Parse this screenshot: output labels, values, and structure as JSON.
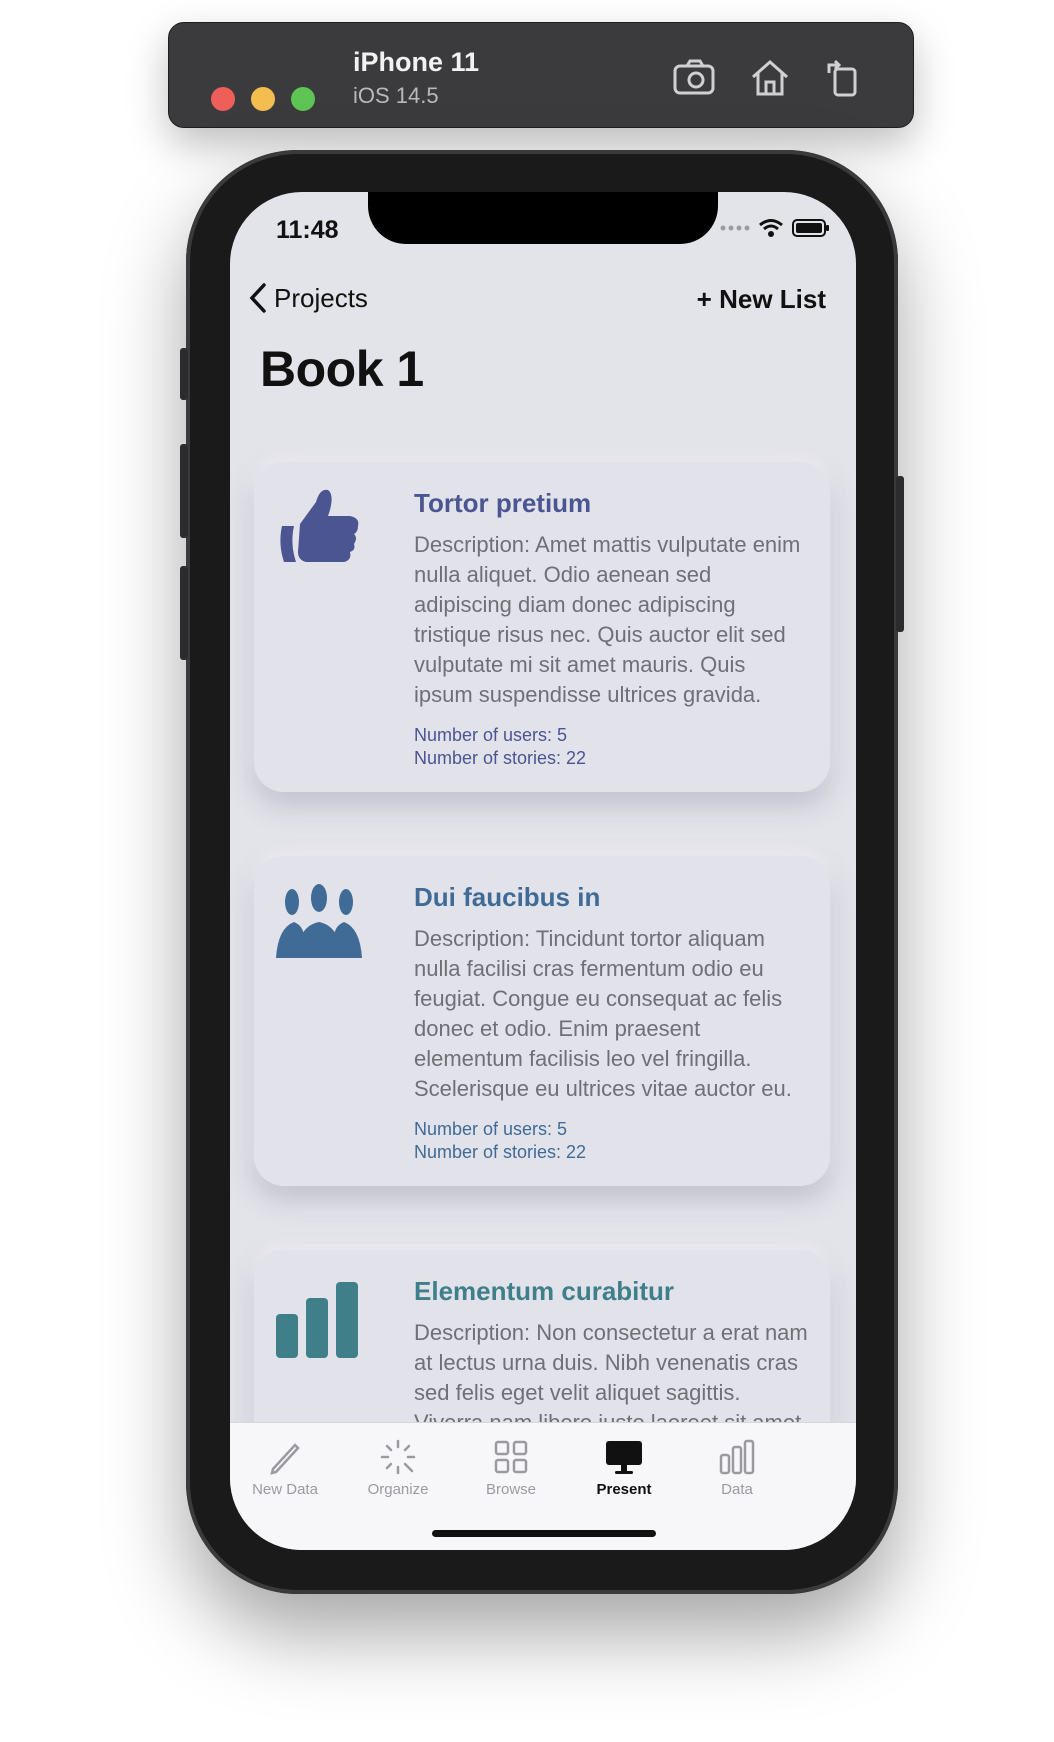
{
  "simulator": {
    "device_name": "iPhone 11",
    "os_version": "iOS 14.5",
    "icons": [
      "screenshot-icon",
      "home-icon",
      "rotate-icon"
    ]
  },
  "status_bar": {
    "time": "11:48"
  },
  "nav": {
    "back_label": "Projects",
    "new_list_label": "+ New List"
  },
  "page": {
    "title": "Book 1"
  },
  "cards": [
    {
      "icon": "thumbs-up-icon",
      "color": "#4a5592",
      "title": "Tortor pretium",
      "description": "Description: Amet mattis vulputate enim nulla aliquet. Odio aenean sed adipiscing diam donec adipiscing tristique risus nec. Quis auctor elit sed vulputate mi sit amet mauris. Quis ipsum suspendisse ultrices gravida.",
      "users": "Number of users: 5",
      "stories": "Number of stories: 22"
    },
    {
      "icon": "people-group-icon",
      "color": "#3f6b96",
      "title": "Dui faucibus in",
      "description": "Description: Tincidunt tortor aliquam nulla facilisi cras fermentum odio eu feugiat. Congue eu consequat ac felis donec et odio. Enim praesent elementum facilisis leo vel fringilla. Scelerisque eu ultrices vitae auctor eu.",
      "users": "Number of users: 5",
      "stories": "Number of stories: 22"
    },
    {
      "icon": "bar-chart-icon",
      "color": "#3f7f8a",
      "title": "Elementum curabitur",
      "description": "Description: Non consectetur a erat nam at lectus urna duis. Nibh venenatis cras sed felis eget velit aliquet sagittis. Viverra nam libero justo laoreet sit amet cursus. Erat.",
      "users": "",
      "stories": ""
    }
  ],
  "tabs": [
    {
      "label": "New Data",
      "icon": "pencil-icon",
      "active": false
    },
    {
      "label": "Organize",
      "icon": "magic-wand-icon",
      "active": false
    },
    {
      "label": "Browse",
      "icon": "grid-icon",
      "active": false
    },
    {
      "label": "Present",
      "icon": "monitor-icon",
      "active": true
    },
    {
      "label": "Data",
      "icon": "bar-chart-outline-icon",
      "active": false
    }
  ]
}
